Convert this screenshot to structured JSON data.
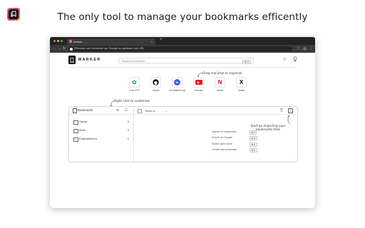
{
  "headline": "The only tool to manage your bookmarks efficently",
  "colors": {
    "accent": "#f0356e",
    "window_chrome": "#2b2b2b",
    "page": "#ffffff"
  },
  "browser": {
    "tab_title": "Marker",
    "tab_close": "×",
    "new_tab": "+",
    "url": "Effectuez une recherche sur Google ou saisissez une URL",
    "nav": {
      "back": "←",
      "forward": "→",
      "reload": "↻"
    },
    "right_icons": {
      "star": "☆",
      "menu": "⋮"
    }
  },
  "app": {
    "name": "MARKER",
    "search_placeholder": "Search Bookmarks...",
    "search_shortcut": "⌘ K",
    "header_icons": {
      "star": "☆",
      "bulb": "💡"
    },
    "shortcuts": [
      {
        "label": "Chat GPT",
        "icon": "chatgpt-icon",
        "color": "#10a37f",
        "glyph": "✿"
      },
      {
        "label": "Github",
        "icon": "github-icon",
        "color": "#111111",
        "glyph": "●"
      },
      {
        "label": "CoinMarketCap",
        "icon": "coinmarketcap-icon",
        "color": "#3861fb",
        "glyph": "M"
      },
      {
        "label": "Youtube",
        "icon": "youtube-icon",
        "color": "#ff0000",
        "glyph": "▶"
      },
      {
        "label": "Netflix",
        "icon": "netflix-icon",
        "color": "#e50914",
        "glyph": "N"
      },
      {
        "label": "Twitter",
        "icon": "x-icon",
        "color": "#000000",
        "glyph": "X"
      }
    ],
    "annotations": {
      "drag": "Drag and drop to organize",
      "right_click": "Right click to customize",
      "import": "Start by importing your bookmarks here"
    },
    "sidebar": {
      "title": "Bookmarks",
      "folders": [
        {
          "name": "Social",
          "count": "0"
        },
        {
          "name": "Work",
          "count": "0"
        },
        {
          "name": "Entertainment",
          "count": "0"
        }
      ]
    },
    "main": {
      "move_to": "Move to ...",
      "move_chevron": "⌄",
      "trash_icon": "🗑",
      "import_icon": "+",
      "shortcuts": [
        {
          "label": "Search on bookmarks",
          "key": "⌘ K"
        },
        {
          "label": "Search on Google",
          "key": "⌘ G"
        },
        {
          "label": "Switch dark mode",
          "key": "⌘ D"
        },
        {
          "label": "Create new bookmark",
          "key": "⌘ N"
        }
      ]
    }
  }
}
